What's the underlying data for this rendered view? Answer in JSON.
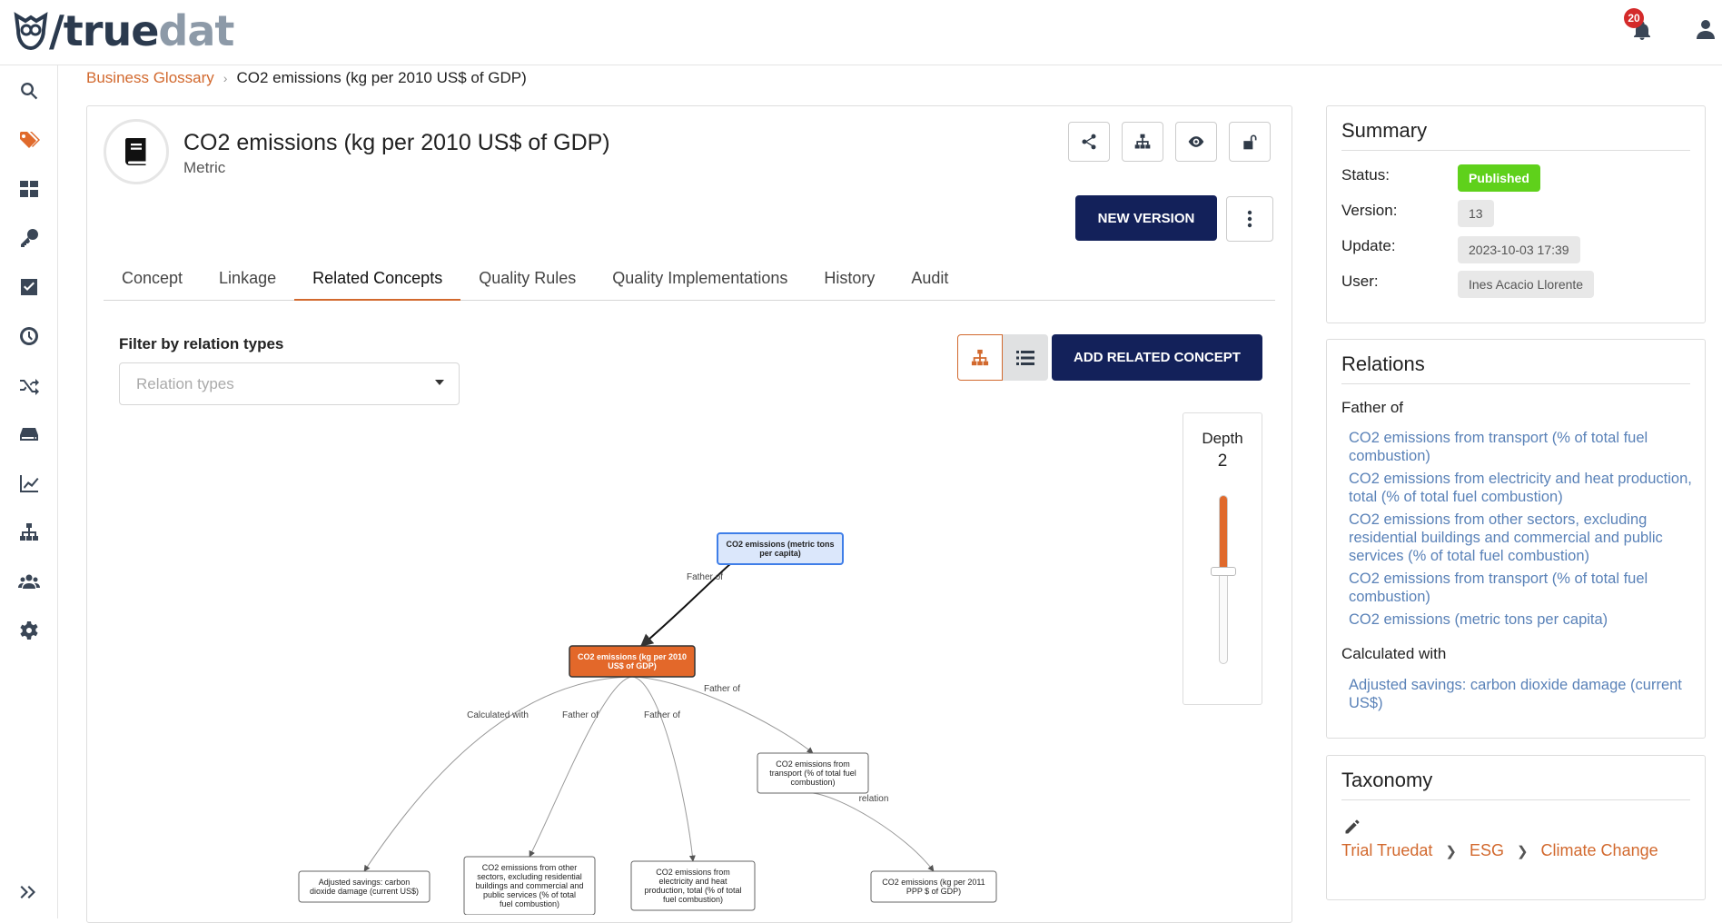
{
  "app": {
    "logo_part1": "/true",
    "logo_part2": "dat",
    "notifications_count": "20"
  },
  "sidebar": {
    "items": [
      {
        "name": "search-icon"
      },
      {
        "name": "tag-icon",
        "active": true
      },
      {
        "name": "dashboard-icon"
      },
      {
        "name": "key-icon"
      },
      {
        "name": "checkbox-icon"
      },
      {
        "name": "gauge-icon"
      },
      {
        "name": "shuffle-icon"
      },
      {
        "name": "storage-icon"
      },
      {
        "name": "chart-line-icon"
      },
      {
        "name": "hierarchy-icon"
      },
      {
        "name": "users-icon"
      },
      {
        "name": "gear-icon"
      },
      {
        "name": "expand-icon"
      }
    ]
  },
  "breadcrumb": {
    "root": "Business Glossary",
    "current": "CO2 emissions (kg per 2010 US$ of GDP)"
  },
  "concept": {
    "title": "CO2 emissions (kg per 2010 US$ of GDP)",
    "type": "Metric",
    "new_version_label": "NEW VERSION"
  },
  "tabs": [
    {
      "label": "Concept"
    },
    {
      "label": "Linkage"
    },
    {
      "label": "Related Concepts",
      "active": true
    },
    {
      "label": "Quality Rules"
    },
    {
      "label": "Quality Implementations"
    },
    {
      "label": "History"
    },
    {
      "label": "Audit"
    }
  ],
  "filter": {
    "label": "Filter by relation types",
    "placeholder": "Relation types"
  },
  "add_related_label": "ADD RELATED CONCEPT",
  "depth": {
    "label": "Depth",
    "value": "2",
    "level_fraction": 0.45
  },
  "graph": {
    "nodes": [
      {
        "id": "n_top",
        "lines": [
          "CO2 emissions (metric tons",
          "per capita)"
        ],
        "style": "highlight"
      },
      {
        "id": "n_center",
        "lines": [
          "CO2 emissions (kg per 2010",
          "US$ of GDP)"
        ],
        "style": "current"
      },
      {
        "id": "n_transport",
        "lines": [
          "CO2 emissions from",
          "transport (% of total fuel",
          "combustion)"
        ],
        "style": "normal"
      },
      {
        "id": "n_adjusted",
        "lines": [
          "Adjusted savings: carbon",
          "dioxide damage (current US$)"
        ],
        "style": "normal"
      },
      {
        "id": "n_other",
        "lines": [
          "CO2 emissions from other",
          "sectors, excluding residential",
          "buildings and commercial and",
          "public services (% of total",
          "fuel combustion)"
        ],
        "style": "normal"
      },
      {
        "id": "n_elec",
        "lines": [
          "CO2 emissions from",
          "electricity and heat",
          "production, total (% of total",
          "fuel combustion)"
        ],
        "style": "normal"
      },
      {
        "id": "n_ppp",
        "lines": [
          "CO2 emissions (kg per 2011",
          "PPP $ of GDP)"
        ],
        "style": "normal"
      }
    ],
    "edges": [
      {
        "from": "n_top",
        "to": "n_center",
        "label": "Father of"
      },
      {
        "from": "n_center",
        "to": "n_adjusted",
        "label": "Calculated with"
      },
      {
        "from": "n_center",
        "to": "n_other",
        "label": "Father of"
      },
      {
        "from": "n_center",
        "to": "n_elec",
        "label": "Father of"
      },
      {
        "from": "n_center",
        "to": "n_transport",
        "label": "Father of"
      },
      {
        "from": "n_transport",
        "to": "n_ppp",
        "label": "relation"
      }
    ]
  },
  "summary": {
    "title": "Summary",
    "status_label": "Status:",
    "status_value": "Published",
    "version_label": "Version:",
    "version_value": "13",
    "update_label": "Update:",
    "update_value": "2023-10-03 17:39",
    "user_label": "User:",
    "user_value": "Ines Acacio Llorente"
  },
  "relations": {
    "title": "Relations",
    "groups": [
      {
        "label": "Father of",
        "items": [
          "CO2 emissions from transport (% of total fuel combustion)",
          "CO2 emissions from electricity and heat production, total (% of total fuel combustion)",
          "CO2 emissions from other sectors, excluding residential buildings and commercial and public services (% of total fuel combustion)",
          "CO2 emissions from transport (% of total fuel combustion)",
          "CO2 emissions (metric tons per capita)"
        ]
      },
      {
        "label": "Calculated with",
        "items": [
          "Adjusted savings: carbon dioxide damage (current US$)"
        ]
      }
    ]
  },
  "taxonomy": {
    "title": "Taxonomy",
    "path": [
      "Trial Truedat",
      "ESG",
      "Climate Change"
    ]
  },
  "colors": {
    "accent": "#d2692e",
    "primary": "#13215a",
    "published": "#5fd11b",
    "link": "#5a82b8"
  }
}
